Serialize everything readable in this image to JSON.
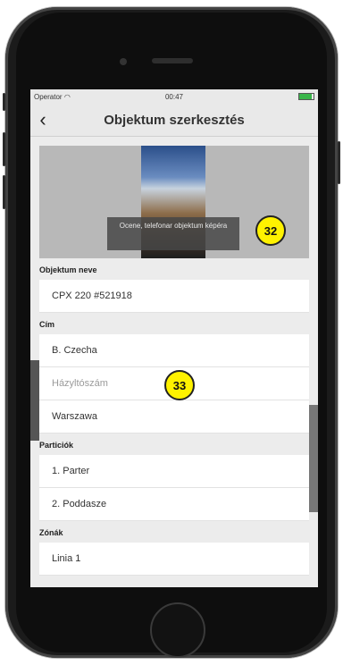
{
  "status": {
    "operator": "Operator",
    "time": "00:47",
    "battery_level": 0.85
  },
  "nav": {
    "title": "Objektum szerkesztés",
    "back_icon": "chevron-left-icon"
  },
  "photo": {
    "hint": "Ocene, telefonar objektum képéra",
    "annotation": "32"
  },
  "object_name": {
    "label": "Objektum neve",
    "value": "CPX 220 #521918"
  },
  "address": {
    "label": "Cím",
    "street": "B. Czecha",
    "house_number_placeholder": "Házyltószám",
    "city": "Warszawa",
    "annotation": "33"
  },
  "partitions": {
    "label": "Particiók",
    "items": [
      "1. Parter",
      "2. Poddasze"
    ]
  },
  "zones": {
    "label": "Zónák",
    "items": [
      "Linia 1"
    ]
  }
}
